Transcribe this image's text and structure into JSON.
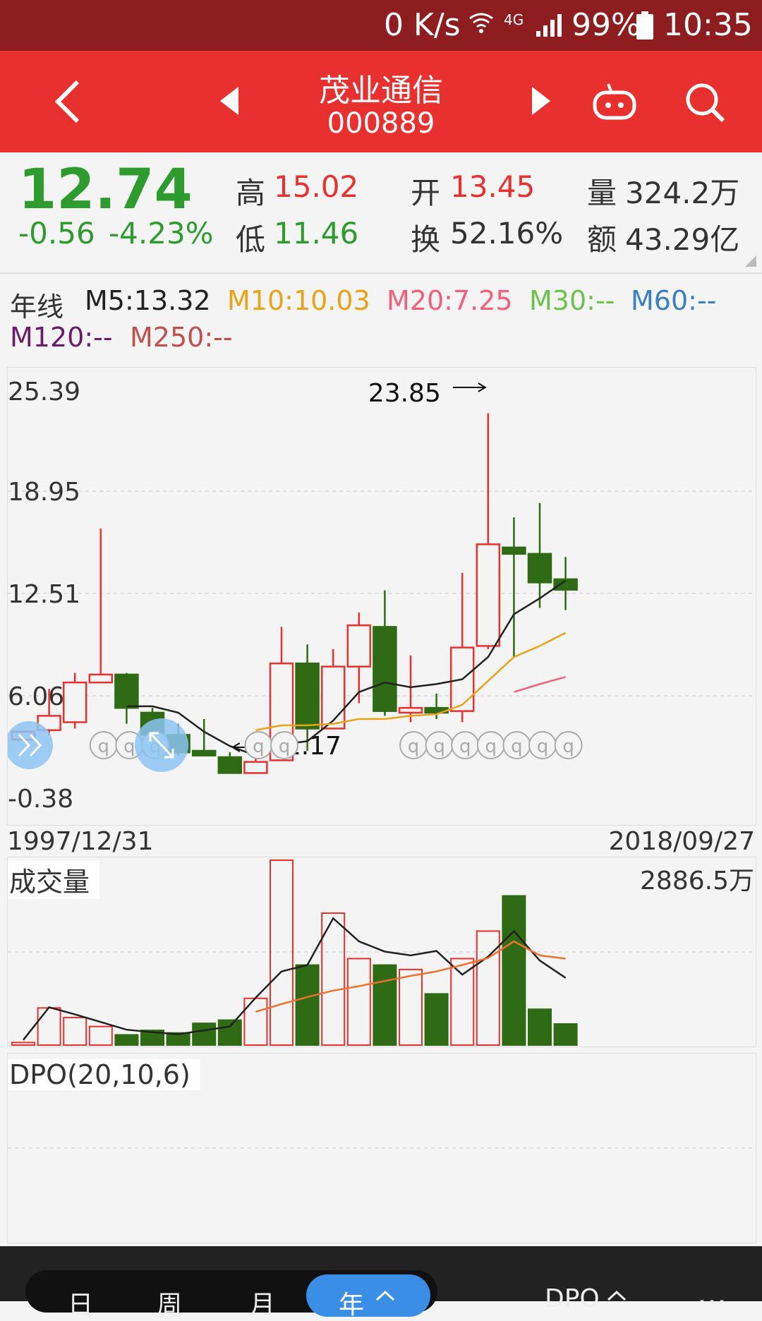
{
  "status_bar": {
    "speed": "0 K/s",
    "network": "4G",
    "battery": "99%",
    "time": "10:35"
  },
  "header": {
    "title": "茂业通信",
    "code": "000889",
    "icons": [
      "back-arrow-icon",
      "prev-triangle-icon",
      "next-triangle-icon",
      "robot-icon",
      "search-icon"
    ]
  },
  "quote": {
    "price": "12.74",
    "change": "-0.56",
    "change_pct": "-4.23%",
    "high_label": "高",
    "high_value": "15.02",
    "low_label": "低",
    "low_value": "11.46",
    "open_label": "开",
    "open_value": "13.45",
    "turnover_label": "换",
    "turnover_value": "52.16%",
    "volume_label": "量",
    "volume_value": "324.2万",
    "amount_label": "额",
    "amount_value": "43.29亿"
  },
  "ma": {
    "period": "年线",
    "m5": "M5:13.32",
    "m10": "M10:10.03",
    "m20": "M20:7.25",
    "m30": "M30:--",
    "m60": "M60:--",
    "m120": "M120:--",
    "m250": "M250:--"
  },
  "colors": {
    "up": "#e8312f",
    "down": "#2e6b14",
    "m5": "#222222",
    "m10": "#e8a317",
    "m20": "#f0607a",
    "m30": "#6cc24a",
    "m60": "#3a7fc1",
    "m120": "#6a1b6a",
    "m250": "#c0504d"
  },
  "chart_data": [
    {
      "type": "candlestick",
      "y_ticks": [
        "25.39",
        "18.95",
        "12.51",
        "6.06",
        "-0.38"
      ],
      "ylim": [
        -0.38,
        25.39
      ],
      "x_start": "1997/12/31",
      "x_end": "2018/09/27",
      "max_marker": "23.85",
      "min_marker": "1.17",
      "candles": [
        {
          "o": 3.3,
          "c": 3.8,
          "h": 3.8,
          "l": 3.3
        },
        {
          "o": 3.9,
          "c": 4.8,
          "h": 6.5,
          "l": 3.6
        },
        {
          "o": 4.4,
          "c": 6.9,
          "h": 7.5,
          "l": 4.0
        },
        {
          "o": 6.9,
          "c": 7.4,
          "h": 16.6,
          "l": 6.9
        },
        {
          "o": 7.4,
          "c": 5.3,
          "h": 7.5,
          "l": 4.3
        },
        {
          "o": 5.0,
          "c": 3.6,
          "h": 5.3,
          "l": 3.6
        },
        {
          "o": 3.6,
          "c": 2.5,
          "h": 4.3,
          "l": 2.3
        },
        {
          "o": 2.6,
          "c": 2.3,
          "h": 4.6,
          "l": 2.3
        },
        {
          "o": 2.2,
          "c": 1.2,
          "h": 2.5,
          "l": 1.17
        },
        {
          "o": 1.2,
          "c": 1.9,
          "h": 2.3,
          "l": 1.17
        },
        {
          "o": 2.0,
          "c": 8.1,
          "h": 10.4,
          "l": 2.0
        },
        {
          "o": 8.1,
          "c": 4.0,
          "h": 9.3,
          "l": 2.6
        },
        {
          "o": 4.0,
          "c": 7.9,
          "h": 9.0,
          "l": 4.0
        },
        {
          "o": 7.9,
          "c": 10.5,
          "h": 11.3,
          "l": 5.6
        },
        {
          "o": 10.4,
          "c": 5.1,
          "h": 12.7,
          "l": 4.8
        },
        {
          "o": 5.0,
          "c": 5.3,
          "h": 8.6,
          "l": 4.4
        },
        {
          "o": 5.3,
          "c": 5.0,
          "h": 6.2,
          "l": 4.6
        },
        {
          "o": 5.1,
          "c": 9.1,
          "h": 13.8,
          "l": 4.4
        },
        {
          "o": 9.2,
          "c": 15.6,
          "h": 23.85,
          "l": 9.0
        },
        {
          "o": 15.4,
          "c": 15.0,
          "h": 17.3,
          "l": 8.5
        },
        {
          "o": 15.0,
          "c": 13.2,
          "h": 18.2,
          "l": 11.6
        },
        {
          "o": 13.4,
          "c": 12.74,
          "h": 14.8,
          "l": 11.46
        }
      ],
      "series": [
        {
          "name": "M5",
          "values": [
            null,
            null,
            null,
            null,
            5.4,
            5.4,
            5.0,
            3.8,
            2.9,
            2.3,
            3.0,
            3.2,
            4.5,
            6.3,
            6.9,
            6.6,
            6.8,
            7.1,
            8.5,
            11.2,
            12.2,
            13.32
          ]
        },
        {
          "name": "M10",
          "values": [
            null,
            null,
            null,
            null,
            null,
            null,
            null,
            null,
            null,
            3.9,
            4.2,
            4.2,
            4.3,
            4.6,
            4.6,
            4.8,
            4.9,
            5.5,
            7.0,
            8.5,
            9.2,
            10.03
          ]
        },
        {
          "name": "M20",
          "values": [
            null,
            null,
            null,
            null,
            null,
            null,
            null,
            null,
            null,
            null,
            null,
            null,
            null,
            null,
            null,
            null,
            null,
            null,
            null,
            6.3,
            6.8,
            7.25
          ]
        }
      ]
    },
    {
      "type": "bar",
      "title": "成交量",
      "max_label": "2886.5万",
      "ylim": [
        0,
        2886.5
      ],
      "values": [
        40,
        580,
        430,
        290,
        160,
        230,
        190,
        340,
        390,
        730,
        2886.5,
        1250,
        2060,
        1350,
        1250,
        1180,
        800,
        1350,
        1780,
        2330,
        560,
        330
      ],
      "up": [
        true,
        true,
        true,
        true,
        false,
        false,
        false,
        false,
        false,
        true,
        true,
        false,
        true,
        true,
        false,
        true,
        false,
        true,
        true,
        false,
        false,
        false
      ],
      "series": [
        {
          "name": "MA5",
          "values": [
            80,
            590,
            480,
            360,
            240,
            200,
            170,
            230,
            290,
            740,
            1150,
            1250,
            1980,
            1620,
            1460,
            1400,
            1470,
            1100,
            1380,
            1780,
            1320,
            1050
          ]
        },
        {
          "name": "MA10",
          "values": [
            null,
            null,
            null,
            null,
            null,
            null,
            null,
            null,
            null,
            520,
            640,
            750,
            850,
            920,
            1000,
            1080,
            1150,
            1250,
            1360,
            1620,
            1400,
            1350
          ]
        }
      ]
    },
    {
      "type": "line",
      "title": "DPO(20,10,6)"
    }
  ],
  "bottom_tabs": {
    "items": [
      "日",
      "周",
      "月",
      "年"
    ],
    "active": "年",
    "right_label": "DPO",
    "more": "..."
  }
}
